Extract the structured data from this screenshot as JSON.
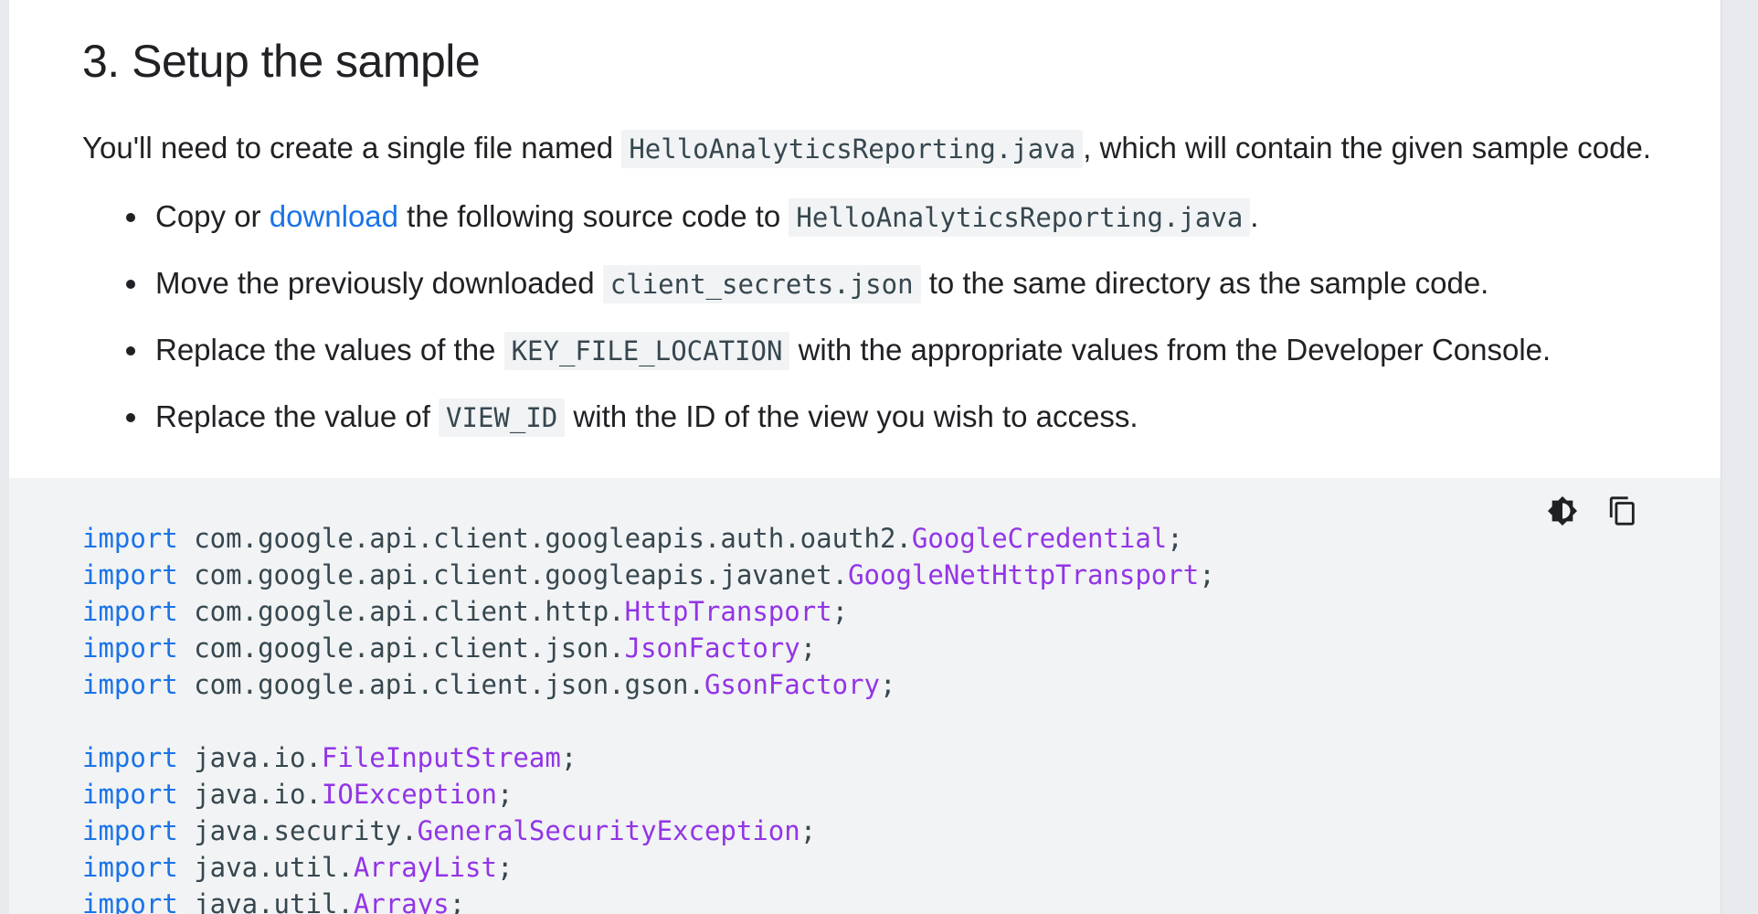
{
  "section": {
    "title": "3. Setup the sample",
    "intro_before": "You'll need to create a single file named ",
    "intro_code": "HelloAnalyticsReporting.java",
    "intro_after": ", which will contain the given sample code."
  },
  "steps": [
    {
      "before": "Copy or ",
      "link": "download",
      "middle": " the following source code to ",
      "code": "HelloAnalyticsReporting.java",
      "after": "."
    },
    {
      "before": "Move the previously downloaded ",
      "code": "client_secrets.json",
      "after": " to the same directory as the sample code."
    },
    {
      "before": "Replace the values of the ",
      "code": "KEY_FILE_LOCATION",
      "after": " with the appropriate values from the Developer Console."
    },
    {
      "before": "Replace the value of ",
      "code": "VIEW_ID",
      "after": " with the ID of the view you wish to access."
    }
  ],
  "code_actions": {
    "theme_icon": "brightness-contrast-icon",
    "copy_icon": "copy-icon"
  },
  "colors": {
    "keyword": "#1a73e8",
    "type": "#9334e6",
    "code_text": "#37474f",
    "code_bg": "#f1f3f4",
    "link": "#1a73e8"
  },
  "code_lines": [
    {
      "kw": "import",
      "pkg": " com.google.api.client.googleapis.auth.oauth2.",
      "type": "GoogleCredential",
      "end": ";"
    },
    {
      "kw": "import",
      "pkg": " com.google.api.client.googleapis.javanet.",
      "type": "GoogleNetHttpTransport",
      "end": ";"
    },
    {
      "kw": "import",
      "pkg": " com.google.api.client.http.",
      "type": "HttpTransport",
      "end": ";"
    },
    {
      "kw": "import",
      "pkg": " com.google.api.client.json.",
      "type": "JsonFactory",
      "end": ";"
    },
    {
      "kw": "import",
      "pkg": " com.google.api.client.json.gson.",
      "type": "GsonFactory",
      "end": ";"
    },
    {
      "kw": "",
      "pkg": "",
      "type": "",
      "end": ""
    },
    {
      "kw": "import",
      "pkg": " java.io.",
      "type": "FileInputStream",
      "end": ";"
    },
    {
      "kw": "import",
      "pkg": " java.io.",
      "type": "IOException",
      "end": ";"
    },
    {
      "kw": "import",
      "pkg": " java.security.",
      "type": "GeneralSecurityException",
      "end": ";"
    },
    {
      "kw": "import",
      "pkg": " java.util.",
      "type": "ArrayList",
      "end": ";"
    },
    {
      "kw": "import",
      "pkg": " java.util.",
      "type": "Arrays",
      "end": ";"
    }
  ]
}
